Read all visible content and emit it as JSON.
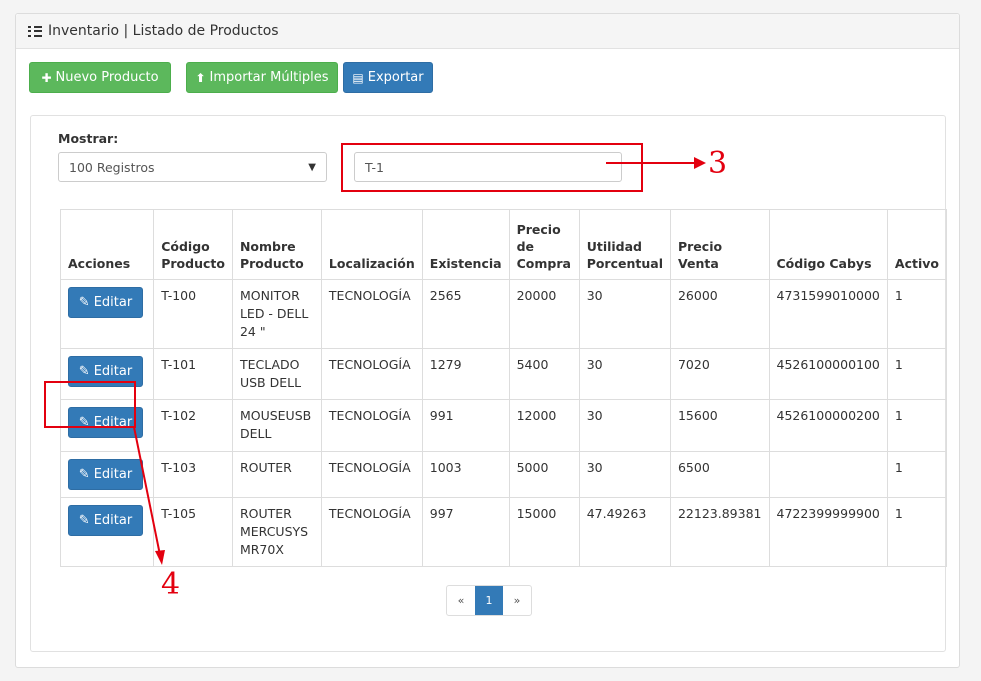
{
  "header": {
    "title": "Inventario | Listado de Productos",
    "icon": "list-icon"
  },
  "toolbar": {
    "new_label": "Nuevo Producto",
    "import_label": "Importar Múltiples",
    "export_label": "Exportar"
  },
  "filters": {
    "show_label": "Mostrar:",
    "show_value": "100 Registros",
    "search_value": "T-1"
  },
  "table": {
    "headers": [
      "Acciones",
      "Código Producto",
      "Nombre Producto",
      "Localización",
      "Existencia",
      "Precio de Compra",
      "Utilidad Porcentual",
      "Precio Venta",
      "Código Cabys",
      "Activo"
    ],
    "edit_label": "Editar",
    "rows": [
      {
        "codigo": "T-100",
        "nombre": "MONITOR LED - DELL 24 \"",
        "loc": "TECNOLOGÍA",
        "existencia": "2565",
        "compra": "20000",
        "utilidad": "30",
        "venta": "26000",
        "cabys": "4731599010000",
        "activo": "1"
      },
      {
        "codigo": "T-101",
        "nombre": "TECLADO USB DELL",
        "loc": "TECNOLOGÍA",
        "existencia": "1279",
        "compra": "5400",
        "utilidad": "30",
        "venta": "7020",
        "cabys": "4526100000100",
        "activo": "1"
      },
      {
        "codigo": "T-102",
        "nombre": "MOUSEUSB DELL",
        "loc": "TECNOLOGÍA",
        "existencia": "991",
        "compra": "12000",
        "utilidad": "30",
        "venta": "15600",
        "cabys": "4526100000200",
        "activo": "1"
      },
      {
        "codigo": "T-103",
        "nombre": "ROUTER",
        "loc": "TECNOLOGÍA",
        "existencia": "1003",
        "compra": "5000",
        "utilidad": "30",
        "venta": "6500",
        "cabys": "",
        "activo": "1"
      },
      {
        "codigo": "T-105",
        "nombre": "ROUTER MERCUSYS MR70X",
        "loc": "TECNOLOGÍA",
        "existencia": "997",
        "compra": "15000",
        "utilidad": "47.49263",
        "venta": "22123.89381",
        "cabys": "4722399999900",
        "activo": "1"
      }
    ]
  },
  "pagination": {
    "prev": "«",
    "current": "1",
    "next": "»"
  },
  "annotations": {
    "label_3": "3",
    "label_4": "4",
    "color": "#e3000f"
  },
  "colors": {
    "green": "#5cb85c",
    "blue": "#337ab7"
  }
}
